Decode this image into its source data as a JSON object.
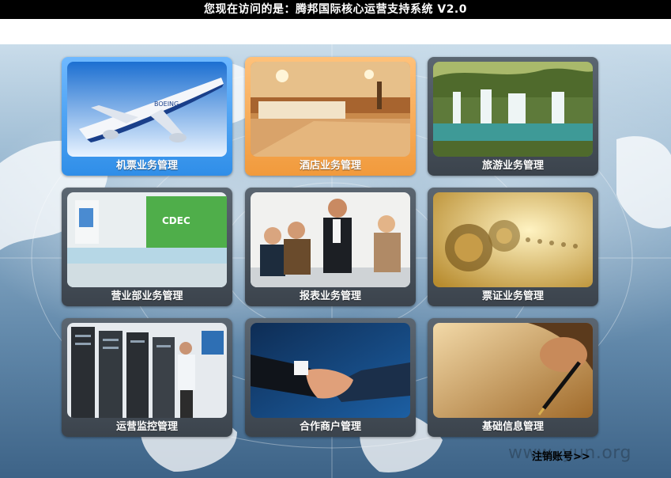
{
  "header": {
    "title": "您现在访问的是：腾邦国际核心运营支持系统  V2.0"
  },
  "tiles": [
    {
      "label": "机票业务管理",
      "icon": "airplane-photo"
    },
    {
      "label": "酒店业务管理",
      "icon": "hotel-lobby-photo"
    },
    {
      "label": "旅游业务管理",
      "icon": "waterfall-photo"
    },
    {
      "label": "营业部业务管理",
      "icon": "office-reception-photo"
    },
    {
      "label": "报表业务管理",
      "icon": "business-meeting-photo"
    },
    {
      "label": "票证业务管理",
      "icon": "gears-photo"
    },
    {
      "label": "运营监控管理",
      "icon": "server-room-photo"
    },
    {
      "label": "合作商户管理",
      "icon": "handshake-photo"
    },
    {
      "label": "基础信息管理",
      "icon": "pen-signature-photo"
    }
  ],
  "footer": {
    "logout_label": "注销账号>>",
    "watermark": "www.  yun.org"
  }
}
